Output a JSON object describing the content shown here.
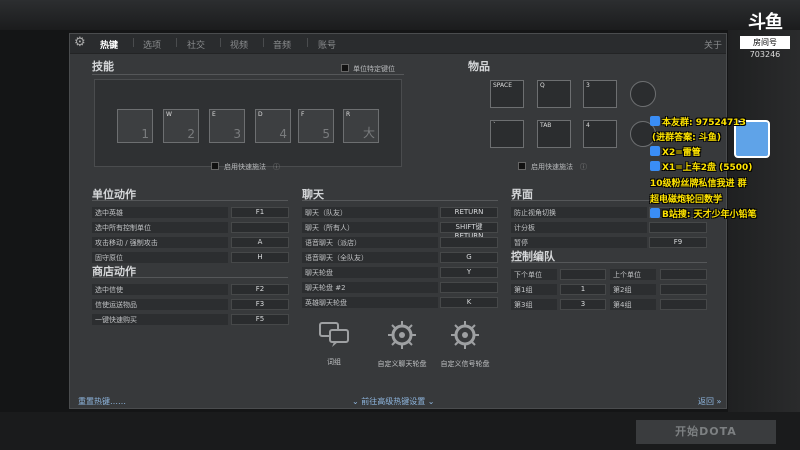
{
  "panel": {
    "tabs": [
      {
        "label": "热键",
        "active": true
      },
      {
        "label": "选项"
      },
      {
        "label": "社交"
      },
      {
        "label": "视频"
      },
      {
        "label": "音频"
      },
      {
        "label": "账号"
      }
    ],
    "close_label": "关于"
  },
  "skills": {
    "title": "技能",
    "ability_lock_label": "单位特定键位",
    "quickcast_label": "启用快速施法",
    "slots": [
      {
        "key": "",
        "num": "1"
      },
      {
        "key": "W",
        "num": "2"
      },
      {
        "key": "E",
        "num": "3"
      },
      {
        "key": "D",
        "num": "4"
      },
      {
        "key": "F",
        "num": "5"
      },
      {
        "key": "R",
        "num": "大"
      }
    ]
  },
  "items": {
    "title": "物品",
    "quickcast_label": "启用快速施法",
    "slots": [
      {
        "key": "SPACE"
      },
      {
        "key": "Q"
      },
      {
        "key": "3"
      },
      {
        "key": "`"
      },
      {
        "key": "TAB"
      },
      {
        "key": "4"
      }
    ]
  },
  "unit_actions": {
    "title": "单位动作",
    "rows": [
      {
        "label": "选中英雄",
        "bind": "F1"
      },
      {
        "label": "选中所有控制单位",
        "bind": ""
      },
      {
        "label": "攻击移动 / 强制攻击",
        "bind": "A"
      },
      {
        "label": "固守原位",
        "bind": "H"
      }
    ]
  },
  "shop_actions": {
    "title": "商店动作",
    "rows": [
      {
        "label": "选中信使",
        "bind": "F2"
      },
      {
        "label": "信使运送物品",
        "bind": "F3"
      },
      {
        "label": "一键快速购买",
        "bind": "F5"
      }
    ]
  },
  "chat": {
    "title": "聊天",
    "rows": [
      {
        "label": "聊天（队友）",
        "bind": "RETURN"
      },
      {
        "label": "聊天（所有人）",
        "bind": "SHIFT键 RETURN"
      },
      {
        "label": "语音聊天（派店）",
        "bind": ""
      },
      {
        "label": "语音聊天（全队友）",
        "bind": "G"
      },
      {
        "label": "聊天轮盘",
        "bind": "Y"
      },
      {
        "label": "聊天轮盘 #2",
        "bind": ""
      },
      {
        "label": "英雄聊天轮盘",
        "bind": "K"
      }
    ]
  },
  "interface": {
    "title": "界面",
    "rows": [
      {
        "label": "防止视角切换",
        "bind": ""
      },
      {
        "label": "计分板",
        "bind": ""
      },
      {
        "label": "暂停",
        "bind": "F9"
      }
    ]
  },
  "control_groups": {
    "title": "控制编队",
    "headers": [
      "下个单位",
      "上个单位"
    ],
    "rows": [
      {
        "left_label": "第1组",
        "left_bind": "1",
        "right_label": "第2组",
        "right_bind": ""
      },
      {
        "left_label": "第3组",
        "left_bind": "3",
        "right_label": "第4组",
        "right_bind": ""
      }
    ]
  },
  "wheels": [
    {
      "label": "词组",
      "icon": "chat-bubbles-icon"
    },
    {
      "label": "自定义聊天轮盘",
      "icon": "wheel-gear-icon"
    },
    {
      "label": "自定义信号轮盘",
      "icon": "wheel-gear-icon"
    }
  ],
  "footer": {
    "reset": "重置热键……",
    "advanced": "前往高级热键设置",
    "back": "返回"
  },
  "background": {
    "play_button": "开始DOTA"
  },
  "stream": {
    "logo": "斗鱼",
    "room_label": "房间号",
    "room_id": "703246",
    "lines": [
      "本友群: 97524713",
      "(进群答案: 斗鱼)",
      "X2=雷管",
      "X1=上车2盘 (5500)",
      "10级粉丝牌私信我进 群",
      "超电磁炮轮回数学",
      "B站搜: 天才少年小铅笔"
    ]
  }
}
